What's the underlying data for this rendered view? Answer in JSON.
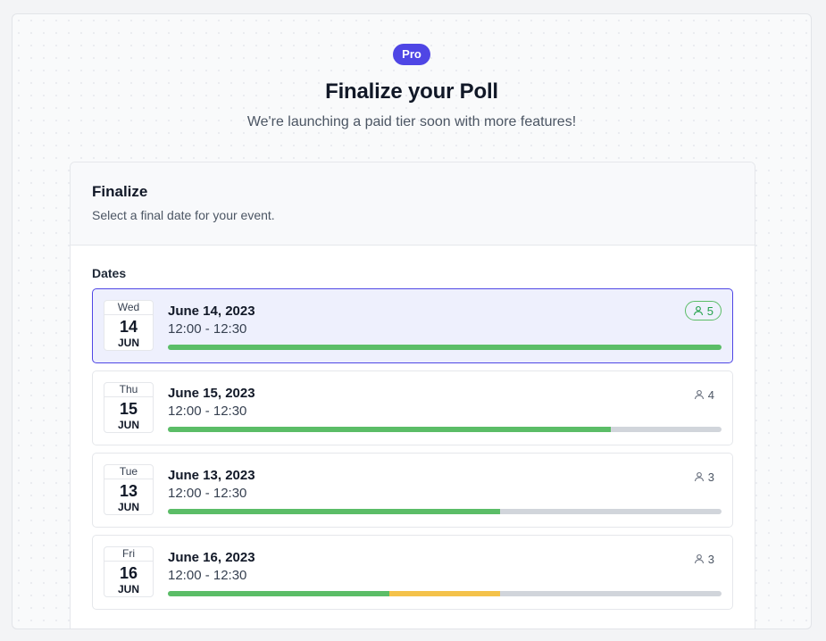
{
  "header": {
    "badge": "Pro",
    "title": "Finalize your Poll",
    "subtitle": "We're launching a paid tier soon with more features!"
  },
  "card": {
    "title": "Finalize",
    "description": "Select a final date for your event."
  },
  "dates_section": {
    "label": "Dates",
    "options": [
      {
        "dow": "Wed",
        "day": "14",
        "month": "JUN",
        "date": "June 14, 2023",
        "time": "12:00 - 12:30",
        "count": "5",
        "selected": true,
        "yes_fraction": 1.0,
        "maybe_fraction": 0.0
      },
      {
        "dow": "Thu",
        "day": "15",
        "month": "JUN",
        "date": "June 15, 2023",
        "time": "12:00 - 12:30",
        "count": "4",
        "selected": false,
        "yes_fraction": 0.8,
        "maybe_fraction": 0.0
      },
      {
        "dow": "Tue",
        "day": "13",
        "month": "JUN",
        "date": "June 13, 2023",
        "time": "12:00 - 12:30",
        "count": "3",
        "selected": false,
        "yes_fraction": 0.6,
        "maybe_fraction": 0.0
      },
      {
        "dow": "Fri",
        "day": "16",
        "month": "JUN",
        "date": "June 16, 2023",
        "time": "12:00 - 12:30",
        "count": "3",
        "selected": false,
        "yes_fraction": 0.4,
        "maybe_fraction": 0.2
      }
    ]
  },
  "colors": {
    "accent": "#4f46e5",
    "yes": "#5bbd67",
    "maybe": "#f4c24a",
    "empty": "#d1d5db"
  },
  "icons": {
    "participants": "user-icon"
  }
}
